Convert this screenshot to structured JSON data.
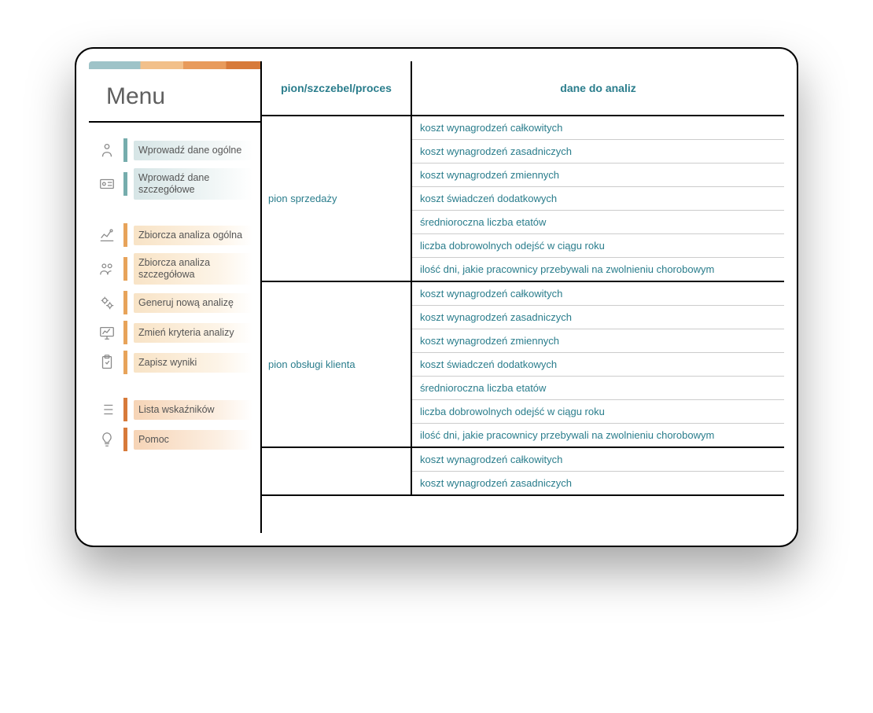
{
  "sidebar": {
    "title": "Menu",
    "items": [
      {
        "label": "Wprowadź dane ogólne",
        "bar": "teal",
        "bg": "teal-bg",
        "icon": "person"
      },
      {
        "label": "Wprowadź dane szczegółowe",
        "bar": "teal",
        "bg": "teal-bg",
        "icon": "id-card"
      },
      {
        "gap": true
      },
      {
        "label": "Zbiorcza analiza ogólna",
        "bar": "orange",
        "bg": "orange-bg",
        "icon": "chart-line"
      },
      {
        "label": "Zbiorcza analiza szczegółowa",
        "bar": "orange",
        "bg": "orange-bg",
        "icon": "people"
      },
      {
        "label": "Generuj nową analizę",
        "bar": "orange",
        "bg": "orange-bg",
        "icon": "gears"
      },
      {
        "label": "Zmień kryteria analizy",
        "bar": "orange",
        "bg": "orange-bg",
        "icon": "monitor"
      },
      {
        "label": "Zapisz wyniki",
        "bar": "orange",
        "bg": "orange-bg",
        "icon": "clipboard"
      },
      {
        "gap": true
      },
      {
        "label": "Lista wskaźników",
        "bar": "darkorange",
        "bg": "dorange-bg",
        "icon": "list"
      },
      {
        "label": "Pomoc",
        "bar": "darkorange",
        "bg": "dorange-bg",
        "icon": "bulb"
      }
    ]
  },
  "table": {
    "headers": {
      "col1": "pion/szczebel/proces",
      "col2": "dane do analiz"
    },
    "groups": [
      {
        "name": "pion sprzedaży",
        "rows": [
          "koszt wynagrodzeń całkowitych",
          "koszt wynagrodzeń zasadniczych",
          "koszt wynagrodzeń zmiennych",
          "koszt świadczeń dodatkowych",
          "średnioroczna liczba etatów",
          "liczba dobrowolnych odejść w ciągu roku",
          "ilość dni, jakie pracownicy przebywali na zwolnieniu chorobowym"
        ]
      },
      {
        "name": "pion obsługi klienta",
        "rows": [
          "koszt wynagrodzeń całkowitych",
          "koszt wynagrodzeń zasadniczych",
          "koszt wynagrodzeń zmiennych",
          "koszt świadczeń dodatkowych",
          "średnioroczna liczba etatów",
          "liczba dobrowolnych odejść w ciągu roku",
          "ilość dni, jakie pracownicy przebywali na zwolnieniu chorobowym"
        ]
      },
      {
        "name": "",
        "rows": [
          "koszt wynagrodzeń całkowitych",
          "koszt wynagrodzeń zasadniczych"
        ]
      }
    ]
  }
}
